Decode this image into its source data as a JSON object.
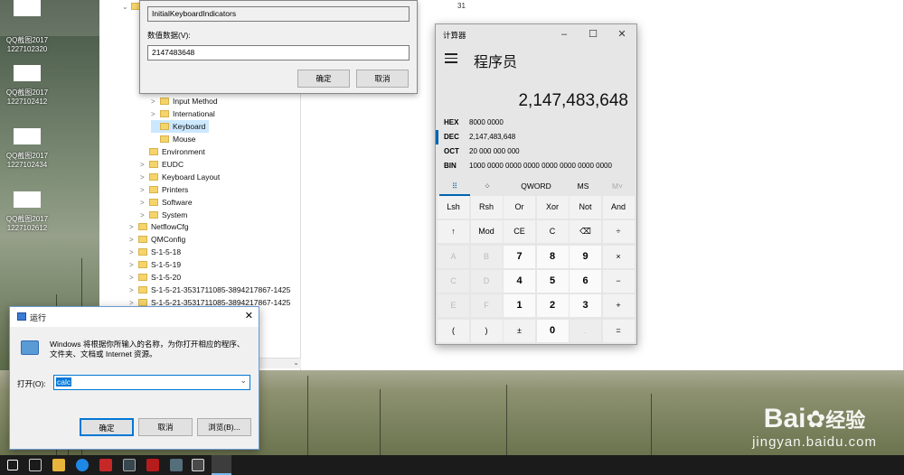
{
  "desktop": {
    "icons": [
      {
        "line1": "QQ截图2017",
        "line2": "1227102320"
      },
      {
        "line1": "QQ截图2017",
        "line2": "1227102412"
      },
      {
        "line1": "QQ截图2017",
        "line2": "1227102434"
      },
      {
        "line1": "QQ截图2017",
        "line2": "1227102612"
      }
    ],
    "top_number": "31"
  },
  "regedit": {
    "tree": [
      {
        "label": "Input Method",
        "arrow": ">"
      },
      {
        "label": "International",
        "arrow": ">"
      },
      {
        "label": "Keyboard",
        "arrow": ""
      },
      {
        "label": "Mouse",
        "arrow": ""
      },
      {
        "label": "Environment",
        "arrow": ""
      },
      {
        "label": "EUDC",
        "arrow": ">"
      },
      {
        "label": "Keyboard Layout",
        "arrow": ">"
      },
      {
        "label": "Printers",
        "arrow": ">"
      },
      {
        "label": "Software",
        "arrow": ">"
      },
      {
        "label": "System",
        "arrow": ">"
      },
      {
        "label": "NetflowCfg",
        "arrow": ">"
      },
      {
        "label": "QMConfig",
        "arrow": ">"
      },
      {
        "label": "S-1-5-18",
        "arrow": ">"
      },
      {
        "label": "S-1-5-19",
        "arrow": ">"
      },
      {
        "label": "S-1-5-20",
        "arrow": ">"
      },
      {
        "label": "S-1-5-21-3531711085-3894217867-1425",
        "arrow": ">"
      },
      {
        "label": "S-1-5-21-3531711085-3894217867-1425",
        "arrow": ">"
      }
    ]
  },
  "edit_dialog": {
    "value_name": "InitialKeyboardIndicators",
    "data_label": "数值数据(V):",
    "value_data": "2147483648",
    "ok": "确定",
    "cancel": "取消"
  },
  "calc": {
    "title": "计算器",
    "mode": "程序员",
    "display": "2,147,483,648",
    "radix": [
      {
        "key": "HEX",
        "val": "8000 0000"
      },
      {
        "key": "DEC",
        "val": "2,147,483,648"
      },
      {
        "key": "OCT",
        "val": "20 000 000 000"
      },
      {
        "key": "BIN",
        "val": "1000 0000 0000 0000 0000 0000 0000 0000"
      }
    ],
    "tabs": {
      "bits": "⠿",
      "word": "QWORD",
      "ms": "MS",
      "mr": "M˅",
      "bitflip": "⁘"
    },
    "keys": [
      [
        "Lsh",
        "Rsh",
        "Or",
        "Xor",
        "Not",
        "And"
      ],
      [
        "↑",
        "Mod",
        "CE",
        "C",
        "⌫",
        "÷"
      ],
      [
        "A",
        "B",
        "7",
        "8",
        "9",
        "×"
      ],
      [
        "C",
        "D",
        "4",
        "5",
        "6",
        "−"
      ],
      [
        "E",
        "F",
        "1",
        "2",
        "3",
        "+"
      ],
      [
        "(",
        ")",
        "±",
        "0",
        ".",
        "="
      ]
    ]
  },
  "run_dialog": {
    "title": "运行",
    "desc1": "Windows 将根据你所输入的名称，为你打开相应的程序、",
    "desc2": "文件夹、文档或 Internet 资源。",
    "open_label": "打开(O):",
    "input_value": "calc",
    "ok": "确定",
    "cancel": "取消",
    "browse": "浏览(B)..."
  },
  "watermark": {
    "brand": "Bai",
    "brand2": "经验",
    "url": "jingyan.baidu.com"
  }
}
